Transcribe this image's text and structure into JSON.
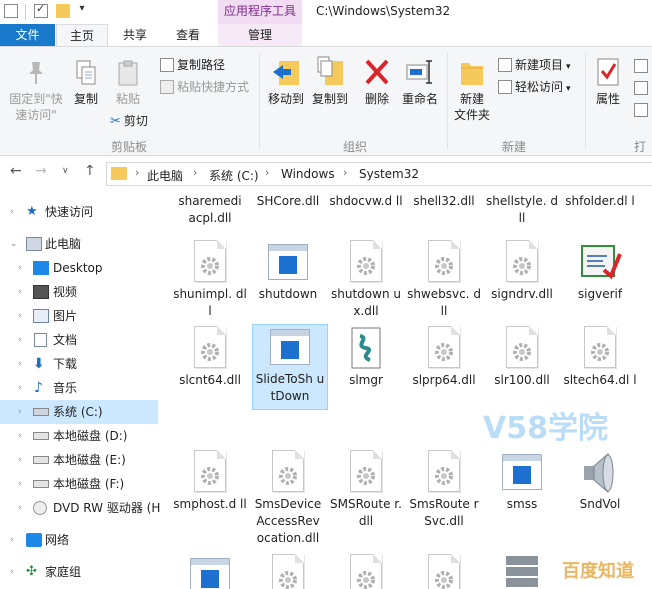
{
  "window": {
    "title": "C:\\Windows\\System32",
    "context_tab": "应用程序工具"
  },
  "tabs": {
    "file": "文件",
    "home": "主页",
    "share": "共享",
    "view": "查看",
    "manage": "管理"
  },
  "ribbon": {
    "clipboard": {
      "pin_line1": "固定到\"快",
      "pin_line2": "速访问\"",
      "copy": "复制",
      "paste": "粘贴",
      "copy_path": "复制路径",
      "paste_shortcut": "粘贴快捷方式",
      "cut": "剪切",
      "group_label": "剪贴板"
    },
    "organize": {
      "move_to": "移动到",
      "copy_to": "复制到",
      "delete": "删除",
      "rename": "重命名",
      "group_label": "组织"
    },
    "new": {
      "new_folder_line1": "新建",
      "new_folder_line2": "文件夹",
      "new_item": "新建项目",
      "easy_access": "轻松访问",
      "group_label": "新建"
    },
    "open": {
      "properties": "属性",
      "group_label": "打开"
    }
  },
  "address": {
    "crumbs": [
      "此电脑",
      "系统 (C:)",
      "Windows",
      "System32"
    ]
  },
  "sidebar": {
    "items": [
      {
        "label": "快速访问"
      },
      {
        "label": "此电脑"
      },
      {
        "label": "Desktop"
      },
      {
        "label": "视频"
      },
      {
        "label": "图片"
      },
      {
        "label": "文档"
      },
      {
        "label": "下载"
      },
      {
        "label": "音乐"
      },
      {
        "label": "系统 (C:)"
      },
      {
        "label": "本地磁盘 (D:)"
      },
      {
        "label": "本地磁盘 (E:)"
      },
      {
        "label": "本地磁盘 (F:)"
      },
      {
        "label": "DVD RW 驱动器 (H"
      },
      {
        "label": "网络"
      },
      {
        "label": "家庭组"
      }
    ]
  },
  "files": {
    "row0": [
      "sharemedi acpl.dll",
      "SHCore.dll",
      "shdocvw.d ll",
      "shell32.dll",
      "shellstyle. dll",
      "shfolder.dl l"
    ],
    "row1": [
      "shunimpl. dll",
      "shutdown",
      "shutdown ux.dll",
      "shwebsvc. dll",
      "signdrv.dll",
      "sigverif"
    ],
    "row2": [
      "slcnt64.dll",
      "SlideToSh utDown",
      "slmgr",
      "slprp64.dll",
      "slr100.dll",
      "sltech64.dl l"
    ],
    "row3": [
      "smphost.d ll",
      "SmsDevice AccessRev ocation.dll",
      "SMSRoute r.dll",
      "SmsRoute rSvc.dll",
      "smss",
      "SndVol"
    ]
  },
  "watermarks": {
    "v58": "V58学院",
    "baidu": "百度知道"
  }
}
